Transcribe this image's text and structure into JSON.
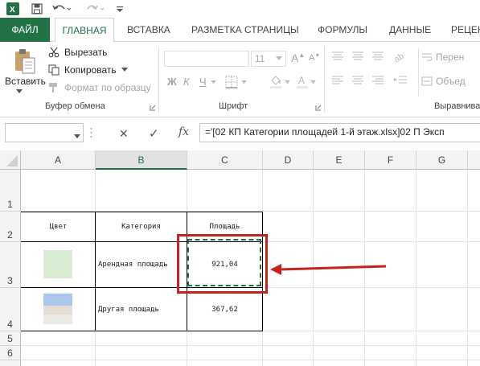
{
  "qat": {
    "save_icon": "save-icon",
    "undo_icon": "undo-icon",
    "redo_icon": "redo-icon",
    "customize_icon": "customize-qat-icon"
  },
  "tabs": {
    "file": "ФАЙЛ",
    "home": "ГЛАВНАЯ",
    "insert": "ВСТАВКА",
    "page_layout": "РАЗМЕТКА СТРАНИЦЫ",
    "formulas": "ФОРМУЛЫ",
    "data": "ДАННЫЕ",
    "review": "РЕЦЕН"
  },
  "ribbon": {
    "clipboard": {
      "paste": "Вставить",
      "cut": "Вырезать",
      "copy": "Копировать",
      "format_painter": "Формат по образцу",
      "label": "Буфер обмена"
    },
    "font": {
      "font_name": "",
      "font_size": "11",
      "bold": "Ж",
      "italic": "К",
      "underline": "Ч",
      "grow": "A",
      "shrink": "A",
      "label": "Шрифт"
    },
    "alignment": {
      "wrap": "Перен",
      "merge": "Объед",
      "label": "Выравнива"
    }
  },
  "formula_bar": {
    "name_box": "",
    "cancel": "✕",
    "enter": "✓",
    "fx": "fx",
    "formula": "='[02 КП Категории площадей 1-й этаж.xlsx]02 П Эксп"
  },
  "grid": {
    "columns": [
      "A",
      "B",
      "C",
      "D",
      "E",
      "F",
      "G"
    ],
    "selected_column": "B",
    "rows": [
      "1",
      "2",
      "3",
      "4",
      "5",
      "6"
    ],
    "table": {
      "headers": [
        "Цвет",
        "Категория",
        "Площадь"
      ],
      "rows": [
        {
          "category": "Арендная площадь",
          "area": "921,04"
        },
        {
          "category": "Другая площадь",
          "area": "367,62"
        }
      ]
    }
  },
  "colors": {
    "accent": "#217346",
    "highlight_box": "#c9211e",
    "arrow": "#c9211e",
    "swatch_green": "#d9ecd4",
    "swatch_blue": "#adc6ec",
    "swatch_gray": "#e8e4de"
  }
}
